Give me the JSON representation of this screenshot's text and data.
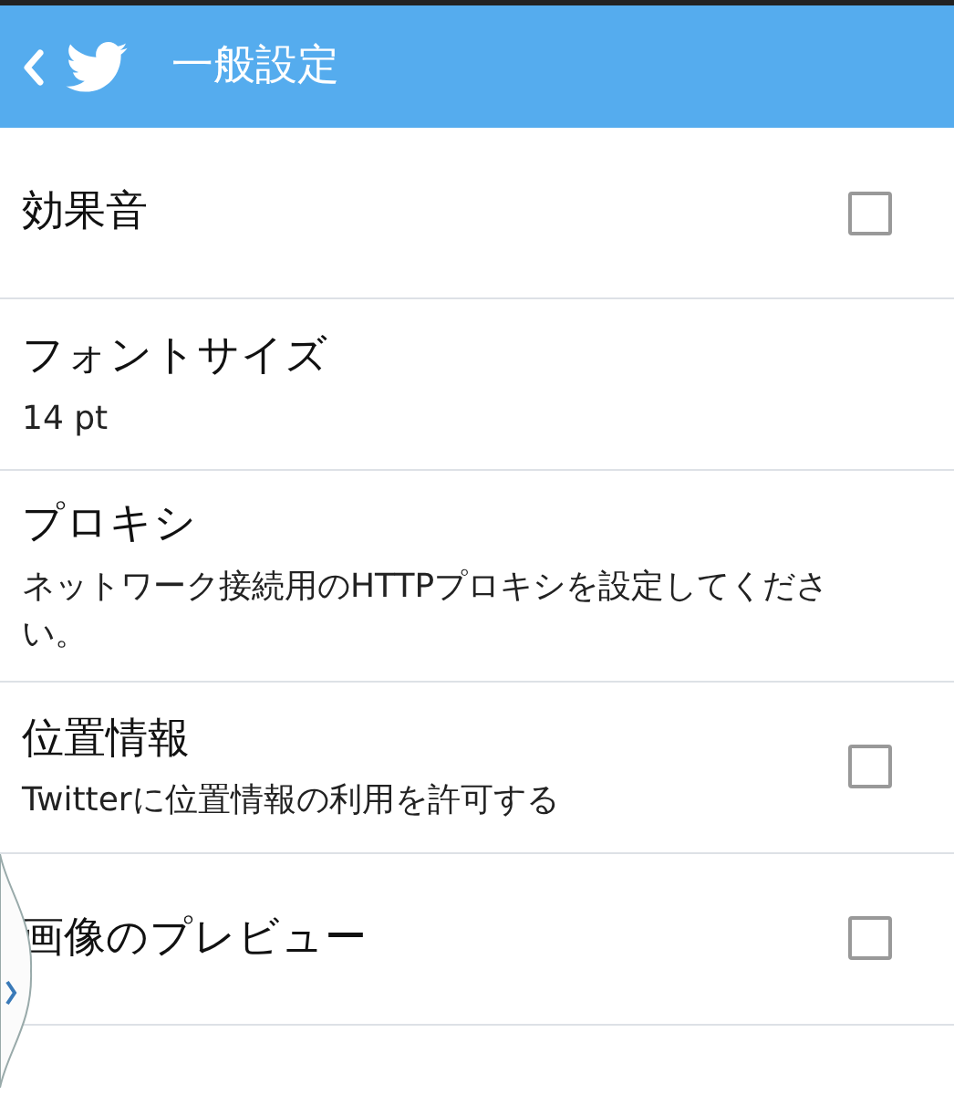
{
  "header": {
    "title": "一般設定"
  },
  "settings": [
    {
      "kind": "checkbox",
      "title": "効果音",
      "checked": false
    },
    {
      "kind": "text",
      "title": "フォントサイズ",
      "summary": "14 pt"
    },
    {
      "kind": "text",
      "title": "プロキシ",
      "summary": "ネットワーク接続用のHTTPプロキシを設定してください。"
    },
    {
      "kind": "checkbox",
      "title": "位置情報",
      "summary": "Twitterに位置情報の利用を許可する",
      "checked": false
    },
    {
      "kind": "checkbox",
      "title": "画像のプレビュー",
      "checked": false
    }
  ]
}
